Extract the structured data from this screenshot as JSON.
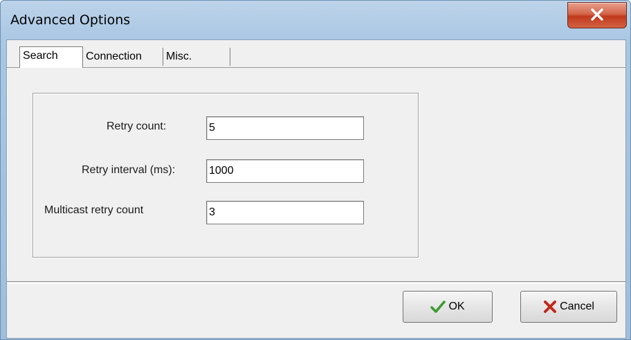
{
  "window": {
    "title": "Advanced Options"
  },
  "tabs": [
    {
      "label": "Search",
      "active": true
    },
    {
      "label": "Connection",
      "active": false
    },
    {
      "label": "Misc.",
      "active": false
    }
  ],
  "search": {
    "retry_count_label": "Retry count:",
    "retry_count_value": "5",
    "retry_interval_label": "Retry interval (ms):",
    "retry_interval_value": "1000",
    "multicast_retry_label": "Multicast retry count",
    "multicast_retry_value": "3"
  },
  "buttons": {
    "ok_label": "OK",
    "ok_icon": "checkmark-icon",
    "cancel_label": "Cancel",
    "cancel_icon": "x-mark-icon"
  },
  "colors": {
    "close_button": "#c8452a",
    "ok_check": "#3c9b2e",
    "cancel_x": "#c0281c"
  }
}
